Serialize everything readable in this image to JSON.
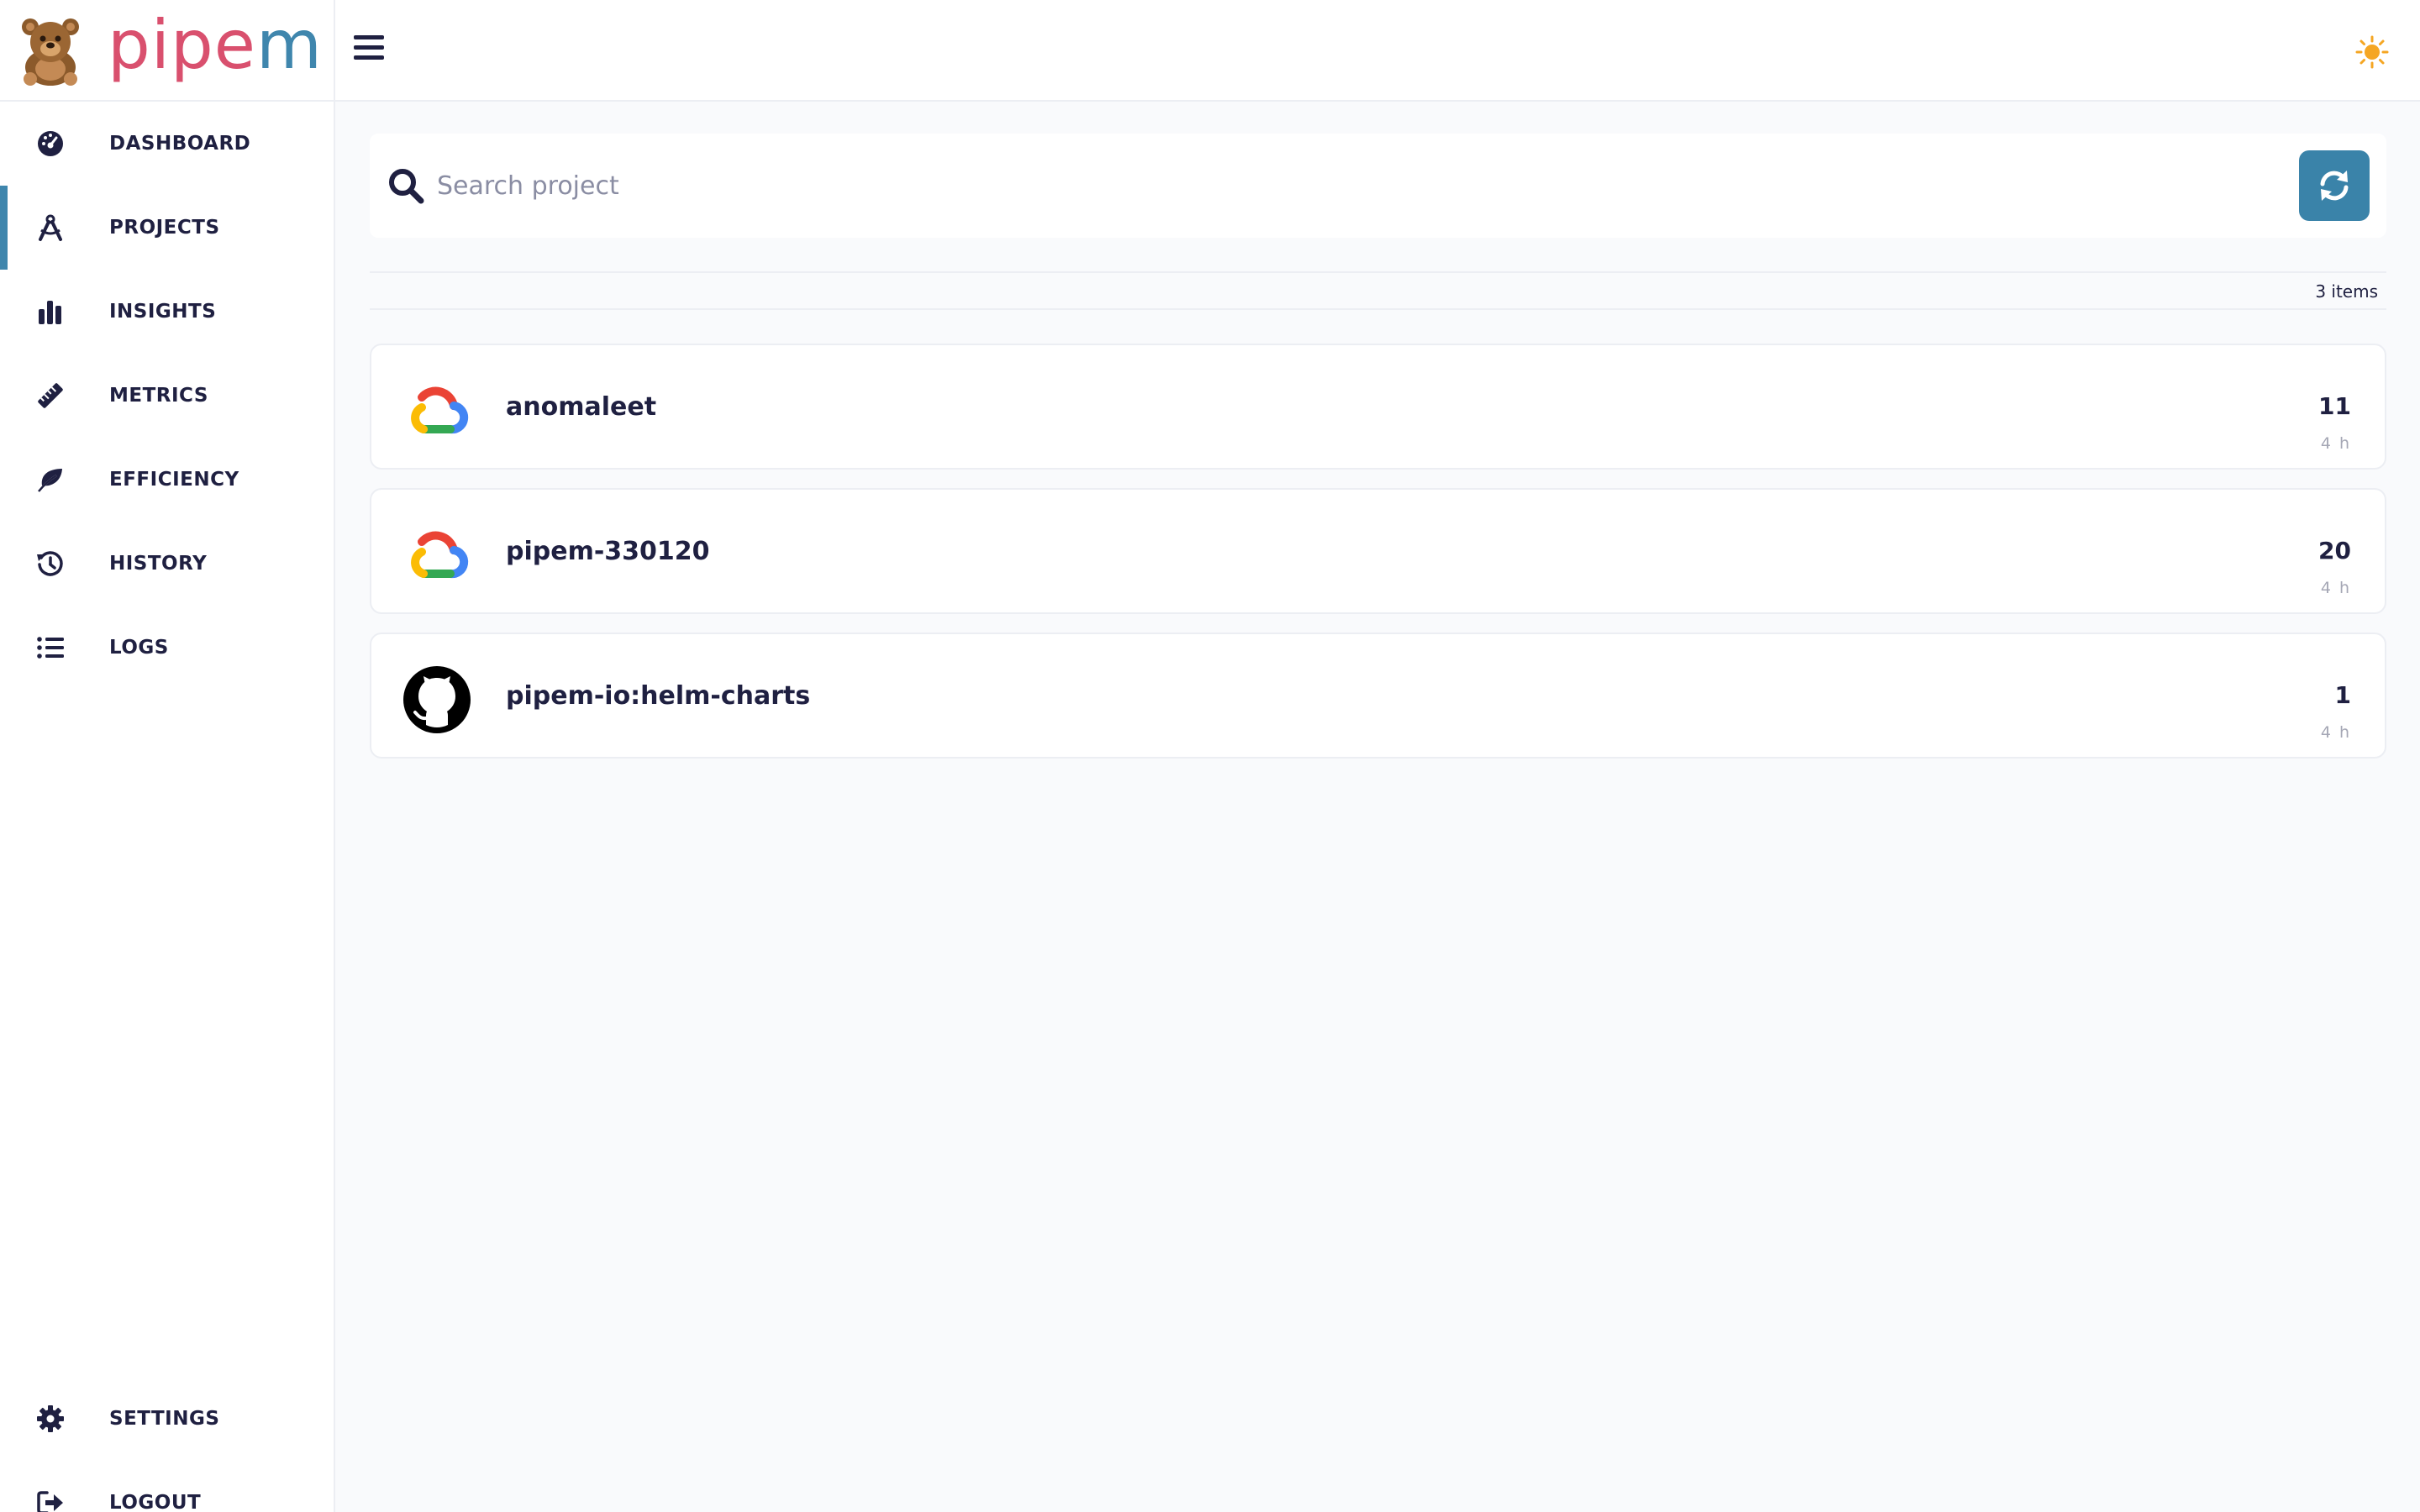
{
  "app": {
    "logo_pipe": "pipe",
    "logo_m": "m"
  },
  "nav": {
    "items": [
      {
        "label": "DASHBOARD",
        "icon": "dashboard-gauge-icon"
      },
      {
        "label": "PROJECTS",
        "icon": "drafting-compass-icon",
        "active": true
      },
      {
        "label": "INSIGHTS",
        "icon": "bar-chart-icon"
      },
      {
        "label": "METRICS",
        "icon": "ruler-icon"
      },
      {
        "label": "EFFICIENCY",
        "icon": "leaf-icon"
      },
      {
        "label": "HISTORY",
        "icon": "history-clock-icon"
      },
      {
        "label": "LOGS",
        "icon": "list-icon"
      }
    ],
    "bottom": [
      {
        "label": "SETTINGS",
        "icon": "gear-icon"
      },
      {
        "label": "LOGOUT",
        "icon": "sign-out-icon"
      }
    ]
  },
  "search": {
    "placeholder": "Search project",
    "value": ""
  },
  "list": {
    "count_text": "3 items",
    "projects": [
      {
        "name": "anomaleet",
        "count": "11",
        "time": "4 h",
        "icon": "google-cloud-icon"
      },
      {
        "name": "pipem-330120",
        "count": "20",
        "time": "4 h",
        "icon": "google-cloud-icon"
      },
      {
        "name": "pipem-io:helm-charts",
        "count": "1",
        "time": "4 h",
        "icon": "github-icon"
      }
    ]
  },
  "colors": {
    "accent": "#3f86ad",
    "logo_pink": "#d9506e",
    "text": "#1f2041",
    "sun": "#f5a623"
  }
}
